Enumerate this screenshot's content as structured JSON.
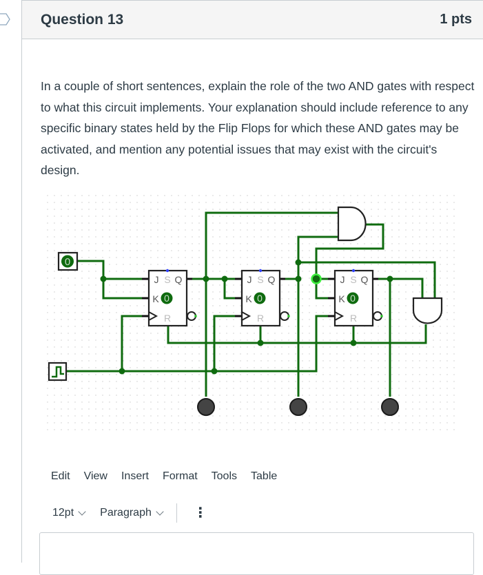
{
  "question": {
    "title": "Question 13",
    "points": "1 pts",
    "text": "In a couple of short sentences, explain the role of the two AND gates with respect to what this circuit implements.   Your explanation should include reference to any specific binary states held by the Flip Flops for which these AND gates may be activated, and mention any potential issues that may exist with the circuit's design."
  },
  "circuit": {
    "input_switch_value": "0",
    "flip_flops": [
      {
        "j": "J",
        "s": "S",
        "q": "Q",
        "k": "K",
        "r": "R",
        "state": "0"
      },
      {
        "j": "J",
        "s": "S",
        "q": "Q",
        "k": "K",
        "r": "R",
        "state": "0"
      },
      {
        "j": "J",
        "s": "S",
        "q": "Q",
        "k": "K",
        "r": "R",
        "state": "0"
      }
    ],
    "colors": {
      "wire": "#0f6b0f",
      "wire_active": "#2ecc2e",
      "led_off": "#444444",
      "pin_blue": "#3344ff"
    }
  },
  "editor": {
    "menu": [
      "Edit",
      "View",
      "Insert",
      "Format",
      "Tools",
      "Table"
    ],
    "font_size": "12pt",
    "block_format": "Paragraph",
    "more_icon": "⋮"
  }
}
